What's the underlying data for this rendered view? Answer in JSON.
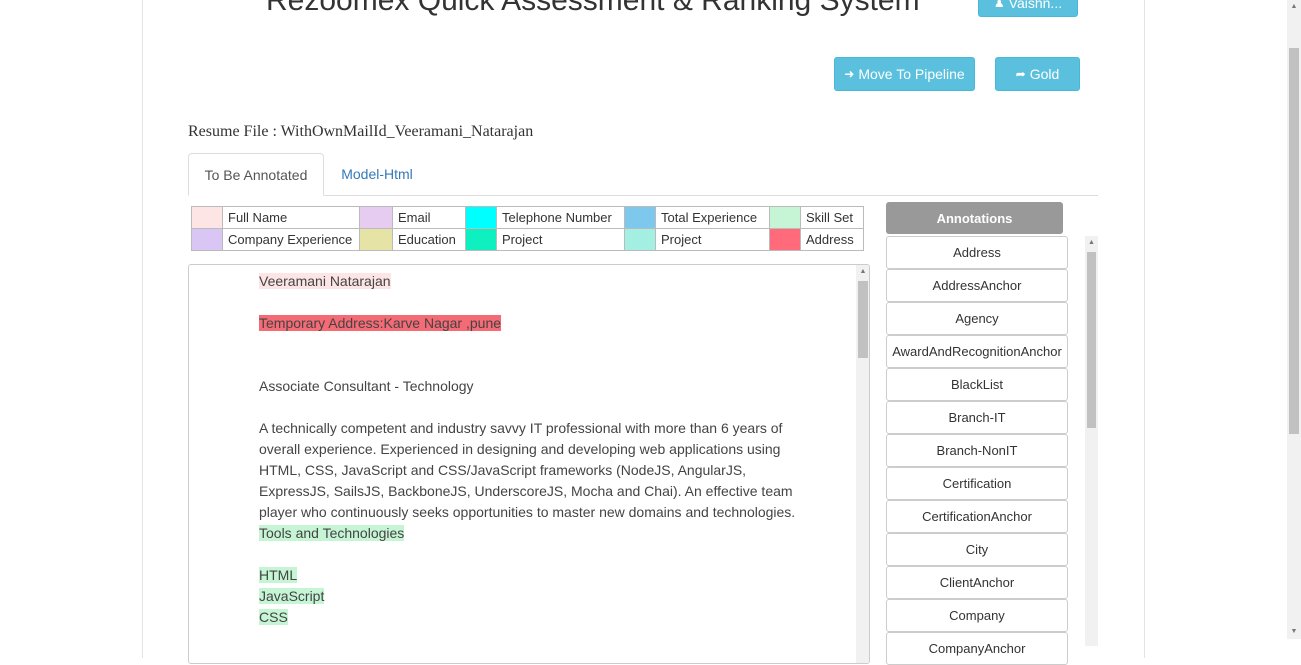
{
  "app": {
    "title": "Rezoomex Quick Assessment & Ranking System"
  },
  "header": {
    "user_button": "Vaishn...",
    "move_to_pipeline": "Move To Pipeline",
    "gold": "Gold"
  },
  "resume": {
    "label": "Resume File : WithOwnMailId_Veeramani_Natarajan"
  },
  "tabs": [
    {
      "label": "To Be Annotated",
      "active": true
    },
    {
      "label": "Model-Html",
      "active": false
    }
  ],
  "legend": {
    "rows": [
      [
        {
          "color": "#fde5e5",
          "label": "Full Name"
        },
        {
          "color": "#e5ccf0",
          "label": "Email"
        },
        {
          "color": "#00ffff",
          "label": "Telephone Number"
        },
        {
          "color": "#7ec8ee",
          "label": "Total Experience"
        },
        {
          "color": "#c6f5d6",
          "label": "Skill Set"
        }
      ],
      [
        {
          "color": "#d9c6f5",
          "label": "Company Experience"
        },
        {
          "color": "#e6e3a7",
          "label": "Education"
        },
        {
          "color": "#0ff0c0",
          "label": "Project"
        },
        {
          "color": "#a3f0e2",
          "label": "Project"
        },
        {
          "color": "#ff6b7a",
          "label": "Address"
        }
      ]
    ]
  },
  "document": {
    "full_name": "Veeramani Natarajan",
    "address": " Temporary Address:Karve Nagar ,pune",
    "designation": "Associate Consultant - Technology",
    "summary": "A technically competent and industry savvy IT professional with more than 6 years of overall experience. Experienced in designing and developing web applications using HTML, CSS, JavaScript and CSS/JavaScript frameworks (NodeJS, AngularJS, ExpressJS, SailsJS, BackboneJS, UnderscoreJS, Mocha and Chai). An effective team player who continuously seeks opportunities to master new domains and technologies.",
    "tools_heading": "Tools and Technologies",
    "skills": [
      "HTML",
      "JavaScript",
      "CSS"
    ],
    "colors": {
      "full_name": "#fde5e5",
      "address": "#f46a75",
      "skill": "#c6f5d6"
    }
  },
  "annotations": {
    "header": "Annotations",
    "items": [
      "Address",
      "AddressAnchor",
      "Agency",
      "AwardAndRecognitionAnchor",
      "BlackList",
      "Branch-IT",
      "Branch-NonIT",
      "Certification",
      "CertificationAnchor",
      "City",
      "ClientAnchor",
      "Company",
      "CompanyAnchor"
    ]
  }
}
